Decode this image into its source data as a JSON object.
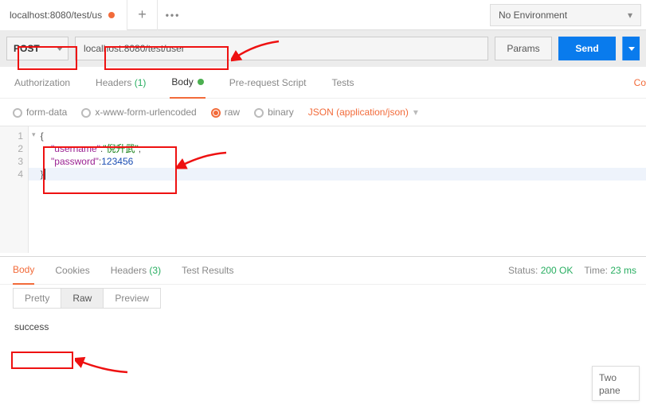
{
  "tabbar": {
    "tab_label": "localhost:8080/test/us",
    "env": "No Environment"
  },
  "request": {
    "method": "POST",
    "url": "localhost:8080/test/user",
    "params_btn": "Params",
    "send_btn": "Send"
  },
  "reqtabs": {
    "auth": "Authorization",
    "headers": "Headers",
    "headers_count": "(1)",
    "body": "Body",
    "prereq": "Pre-request Script",
    "tests": "Tests",
    "co": "Co"
  },
  "bodytypes": {
    "form": "form-data",
    "xwww": "x-www-form-urlencoded",
    "raw": "raw",
    "binary": "binary",
    "content_type": "JSON (application/json)"
  },
  "editor": {
    "gutter": [
      "1",
      "2",
      "3",
      "4"
    ],
    "line1": "{",
    "line2_key": "\"username\"",
    "line2_val": "\"倪升武\"",
    "line3_key": "\"password\"",
    "line3_val": "123456",
    "line4": "}"
  },
  "response": {
    "tabs": {
      "body": "Body",
      "cookies": "Cookies",
      "headers": "Headers",
      "headers_count": "(3)",
      "tests": "Test Results"
    },
    "status_label": "Status:",
    "status_value": "200 OK",
    "time_label": "Time:",
    "time_value": "23 ms",
    "viewmodes": {
      "pretty": "Pretty",
      "raw": "Raw",
      "preview": "Preview"
    },
    "body_text": "success"
  },
  "popup": {
    "l1": "Two",
    "l2": "pane"
  }
}
